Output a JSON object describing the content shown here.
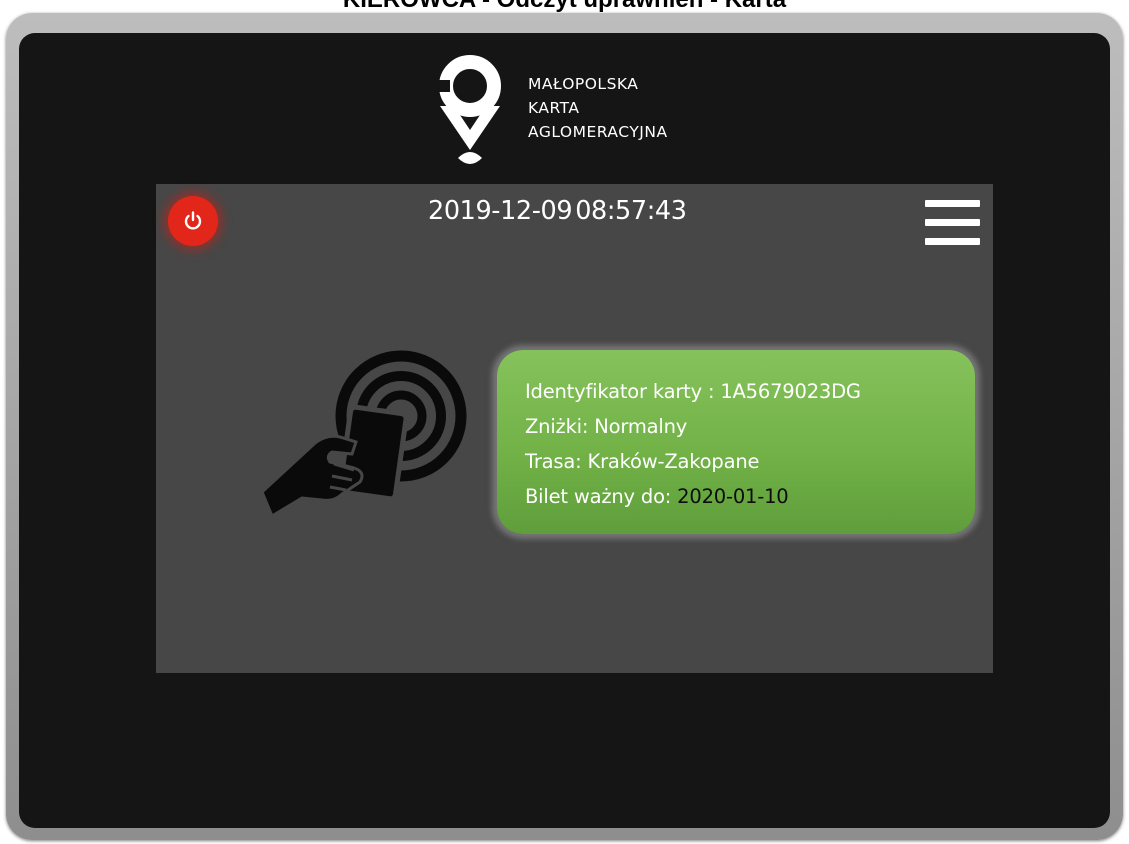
{
  "page": {
    "title": "KIEROWCA - Odczyt uprawnień - Karta"
  },
  "logo": {
    "lines": [
      "MAŁOPOLSKA",
      "KARTA",
      "AGLOMERACYJNA"
    ]
  },
  "header": {
    "date": "2019-12-09",
    "time": "08:57:43",
    "power_icon": "power-icon",
    "menu_icon": "hamburger-menu-icon"
  },
  "card_reader": {
    "icon": "contactless-card-tap-icon"
  },
  "card_info": {
    "id_label": "Identyfikator karty : ",
    "id_value": "1A5679023DG",
    "discount_label": "Zniżki: ",
    "discount_value": "Normalny",
    "route_label": "Trasa: ",
    "route_value": "Kraków-Zakopane",
    "valid_label": "Bilet ważny do: ",
    "valid_value": "2020-01-10"
  },
  "colors": {
    "panel_green": "#72b247",
    "power_red": "#e2261a",
    "screen_gray": "#474747",
    "bezel_black": "#151515"
  }
}
